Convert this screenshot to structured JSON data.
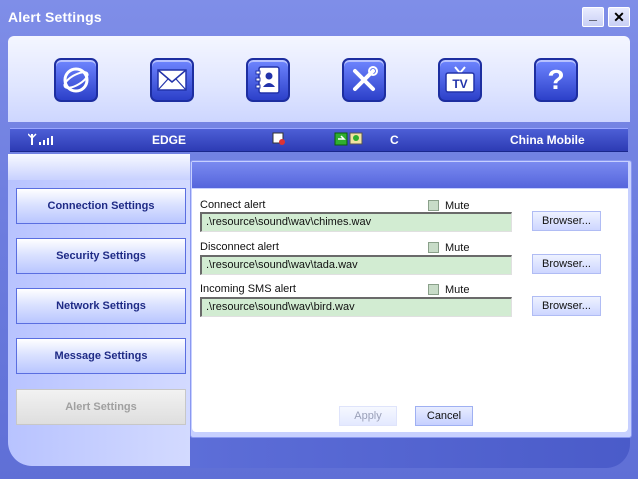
{
  "window": {
    "title": "Alert Settings",
    "minimize_glyph": "_",
    "close_glyph": "✕"
  },
  "toolbar": {
    "icons": [
      "globe-icon",
      "mail-icon",
      "contacts-icon",
      "tools-icon",
      "tv-icon",
      "help-icon"
    ],
    "tv_text": "TV",
    "help_text": "?"
  },
  "status": {
    "network_type": "EDGE",
    "connection_letter": "C",
    "carrier": "China Mobile"
  },
  "sidebar": {
    "items": [
      {
        "label": "Connection Settings"
      },
      {
        "label": "Security Settings"
      },
      {
        "label": "Network Settings"
      },
      {
        "label": "Message Settings"
      },
      {
        "label": "Alert Settings",
        "active": true
      }
    ]
  },
  "alerts": [
    {
      "label": "Connect alert",
      "mute_label": "Mute",
      "mute_checked": false,
      "path": ".\\resource\\sound\\wav\\chimes.wav",
      "browse_label": "Browser..."
    },
    {
      "label": "Disconnect alert",
      "mute_label": "Mute",
      "mute_checked": false,
      "path": ".\\resource\\sound\\wav\\tada.wav",
      "browse_label": "Browser..."
    },
    {
      "label": "Incoming SMS alert",
      "mute_label": "Mute",
      "mute_checked": false,
      "path": ".\\resource\\sound\\wav\\bird.wav",
      "browse_label": "Browser..."
    }
  ],
  "actions": {
    "apply_label": "Apply",
    "apply_enabled": false,
    "cancel_label": "Cancel"
  },
  "colors": {
    "frame": "#6f7fe0",
    "toolbar_icon": "#2c40c9",
    "field_bg": "#d2ecd2",
    "active_nav": "#dedede"
  }
}
